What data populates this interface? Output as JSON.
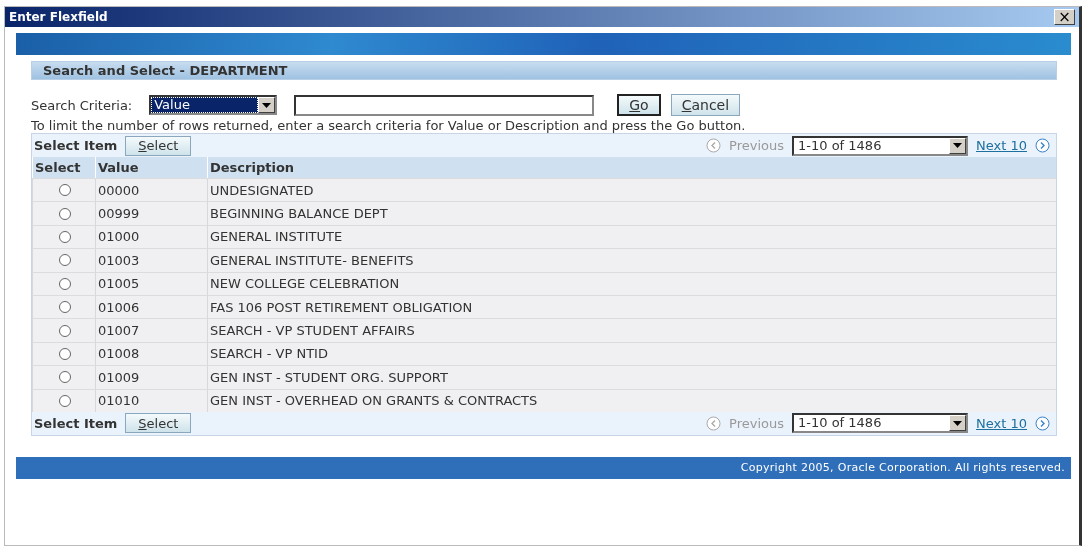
{
  "window": {
    "title": "Enter Flexfield",
    "close": "×"
  },
  "section_title": "Search and Select - DEPARTMENT",
  "search": {
    "label": "Search Criteria:",
    "criteria": "Value",
    "go": "Go",
    "cancel": "Cancel"
  },
  "hint": "To limit the number of rows returned, enter a search criteria for Value or Description and press the Go button.",
  "toolbar": {
    "label": "Select Item",
    "button": "Select",
    "previous": "Previous",
    "range": "1-10 of 1486",
    "next": "Next 10"
  },
  "table": {
    "columns": [
      "Select",
      "Value",
      "Description"
    ],
    "rows": [
      {
        "value": "00000",
        "description": "UNDESIGNATED",
        "selected": false
      },
      {
        "value": "00999",
        "description": "BEGINNING BALANCE DEPT",
        "selected": false
      },
      {
        "value": "01000",
        "description": "GENERAL INSTITUTE",
        "selected": false
      },
      {
        "value": "01003",
        "description": "GENERAL INSTITUTE- BENEFITS",
        "selected": false
      },
      {
        "value": "01005",
        "description": "NEW COLLEGE CELEBRATION",
        "selected": false
      },
      {
        "value": "01006",
        "description": "FAS 106 POST RETIREMENT OBLIGATION",
        "selected": false
      },
      {
        "value": "01007",
        "description": "SEARCH - VP STUDENT AFFAIRS",
        "selected": false
      },
      {
        "value": "01008",
        "description": "SEARCH - VP NTID",
        "selected": false
      },
      {
        "value": "01009",
        "description": "GEN INST - STUDENT ORG. SUPPORT",
        "selected": false
      },
      {
        "value": "01010",
        "description": "GEN INST - OVERHEAD ON GRANTS & CONTRACTS",
        "selected": false
      }
    ]
  },
  "bottom_toolbar": {
    "label": "Select Item",
    "button": "Select",
    "previous": "Previous",
    "range": "1-10 of 1486",
    "next": "Next 10"
  },
  "footer": "Copyright 2005, Oracle Corporation. All rights reserved."
}
